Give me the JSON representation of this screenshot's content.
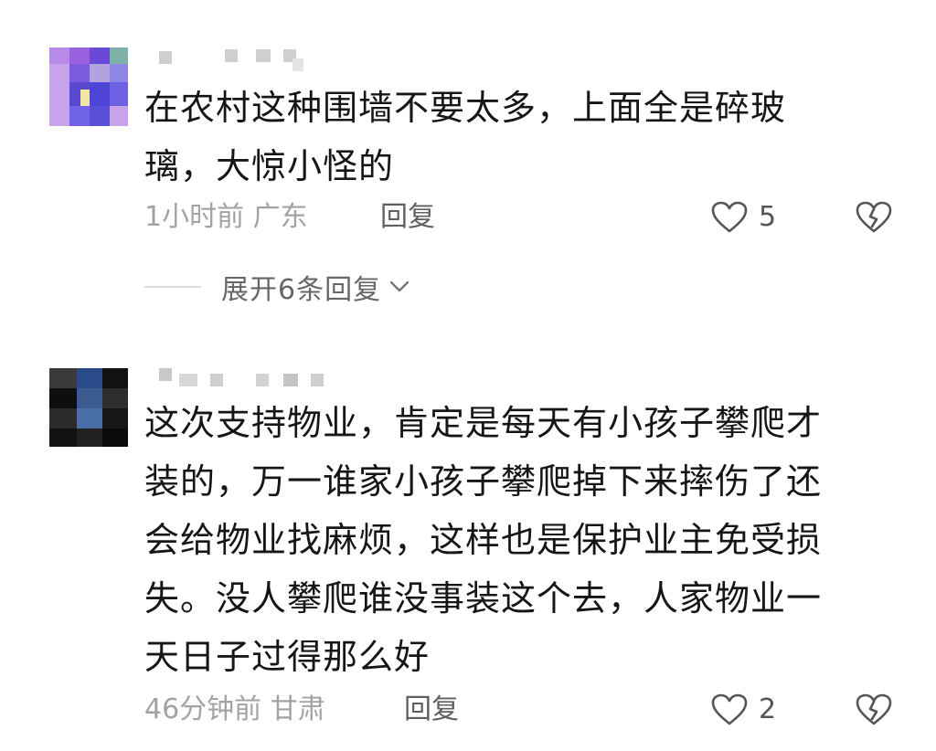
{
  "comments": [
    {
      "text": "在农村这种围墙不要太多，上面全是碎玻\n璃，大惊小怪的",
      "time_location": "1小时前 广东",
      "reply_label": "回复",
      "like_count": "5",
      "like_icon": "heart-outline-icon",
      "dislike_icon": "broken-heart-icon",
      "expand_replies_label": "展开6条回复"
    },
    {
      "text": "这次支持物业，肯定是每天有小孩子攀爬才\n装的，万一谁家小孩子攀爬掉下来摔伤了还\n会给物业找麻烦，这样也是保护业主免受损\n失。没人攀爬谁没事装这个去，人家物业一\n天日子过得那么好",
      "time_location": "46分钟前 甘肃",
      "reply_label": "回复",
      "like_count": "2",
      "like_icon": "heart-outline-icon",
      "dislike_icon": "broken-heart-icon"
    }
  ],
  "colors": {
    "text": "#161616",
    "meta": "#a3a3a3",
    "reply": "#5f5f5f",
    "icon": "#555555"
  }
}
